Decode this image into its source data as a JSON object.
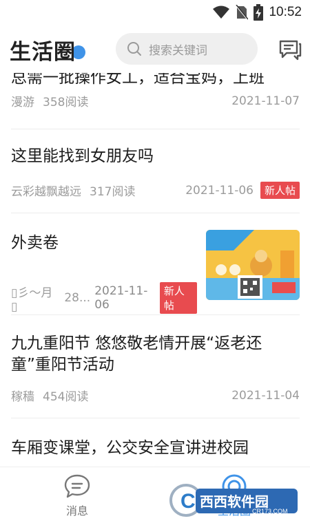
{
  "status": {
    "time": "10:52"
  },
  "header": {
    "title": "生活圈",
    "search_placeholder": "搜索关键词"
  },
  "posts": [
    {
      "title": "总需一批操作女工，适合宝妈，上班",
      "author": "漫游",
      "reads": "358阅读",
      "date": "2021-11-07",
      "badge": ""
    },
    {
      "title": "这里能找到女朋友吗",
      "author": "云彩越飘越远",
      "reads": "317阅读",
      "date": "2021-11-06",
      "badge": "新人帖"
    },
    {
      "title": "外卖卷",
      "author": "▯彡〜月▯",
      "reads": "28...",
      "date": "2021-11-06",
      "badge": "新人帖"
    },
    {
      "title": "九九重阳节 悠悠敬老情开展“返老还童”重阳节活动",
      "author": "稼穑",
      "reads": "454阅读",
      "date": "2021-11-04",
      "badge": ""
    },
    {
      "title": "车厢变课堂，公交安全宣讲进校园",
      "author": "",
      "reads": "",
      "date": "",
      "badge": ""
    }
  ],
  "tabs": {
    "messages": "消息",
    "circle": "生活圈"
  },
  "watermark": {
    "main": "西西软件园",
    "sub": "CR173.COM"
  },
  "colors": {
    "accent": "#3f93e8",
    "badge": "#e84b4f"
  }
}
